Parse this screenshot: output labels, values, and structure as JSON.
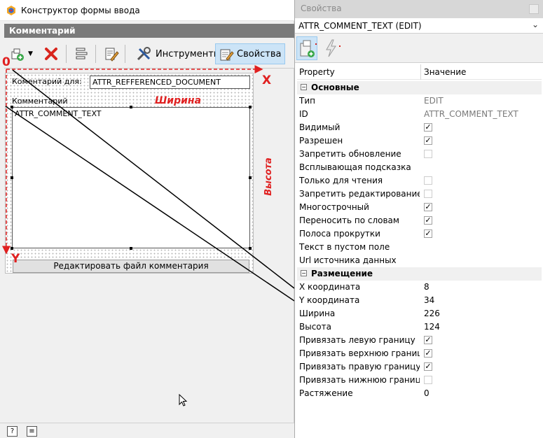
{
  "designer": {
    "title": "Конструктор формы ввода",
    "panel_header": "Комментарий",
    "toolbar": {
      "tools_label": "Инструменты",
      "props_label": "Свойства"
    },
    "form": {
      "comment_for_label": "Коментарий для:",
      "ref_doc_value": "ATTR_REFFERENCED_DOCUMENT",
      "comment_label": "Комментарий",
      "memo_value": "ATTR_COMMENT_TEXT",
      "edit_button": "Редактировать файл комментария"
    },
    "annotations": {
      "origin": "0",
      "x_axis": "X",
      "y_axis": "Y",
      "width": "Ширина",
      "height": "Высота"
    },
    "bottom": {
      "help_icon": "?"
    }
  },
  "properties": {
    "title": "Свойства",
    "selected_object": "ATTR_COMMENT_TEXT (EDIT)",
    "columns": {
      "property": "Property",
      "value": "Значение"
    },
    "sections": [
      {
        "name": "Основные",
        "rows": [
          {
            "name": "Тип",
            "value": "EDIT",
            "gray": true
          },
          {
            "name": "ID",
            "value": "ATTR_COMMENT_TEXT",
            "gray": true
          },
          {
            "name": "Видимый",
            "check": true
          },
          {
            "name": "Разрешен",
            "check": true
          },
          {
            "name": "Запретить обновление",
            "check": false
          },
          {
            "name": "Всплывающая подсказка",
            "value": ""
          },
          {
            "name": "Только для чтения",
            "check": false
          },
          {
            "name": "Запретить редактирование п...",
            "check": false
          },
          {
            "name": "Многострочный",
            "check": true
          },
          {
            "name": "Переносить по словам",
            "check": true
          },
          {
            "name": "Полоса прокрутки",
            "check": true
          },
          {
            "name": "Текст в пустом поле",
            "value": ""
          },
          {
            "name": "Url источника данных",
            "value": ""
          }
        ]
      },
      {
        "name": "Размещение",
        "rows": [
          {
            "name": "X координата",
            "value": "8"
          },
          {
            "name": "Y координата",
            "value": "34"
          },
          {
            "name": "Ширина",
            "value": "226"
          },
          {
            "name": "Высота",
            "value": "124"
          },
          {
            "name": "Привязать левую границу",
            "check": true
          },
          {
            "name": "Привязать верхнюю границу",
            "check": true
          },
          {
            "name": "Привязать правую границу",
            "check": true
          },
          {
            "name": "Привязать нижнюю границу",
            "check": false
          },
          {
            "name": "Растяжение",
            "value": "0"
          }
        ]
      }
    ]
  },
  "colors": {
    "accent_red": "#e02020",
    "selection_blue": "#cce4f7"
  }
}
